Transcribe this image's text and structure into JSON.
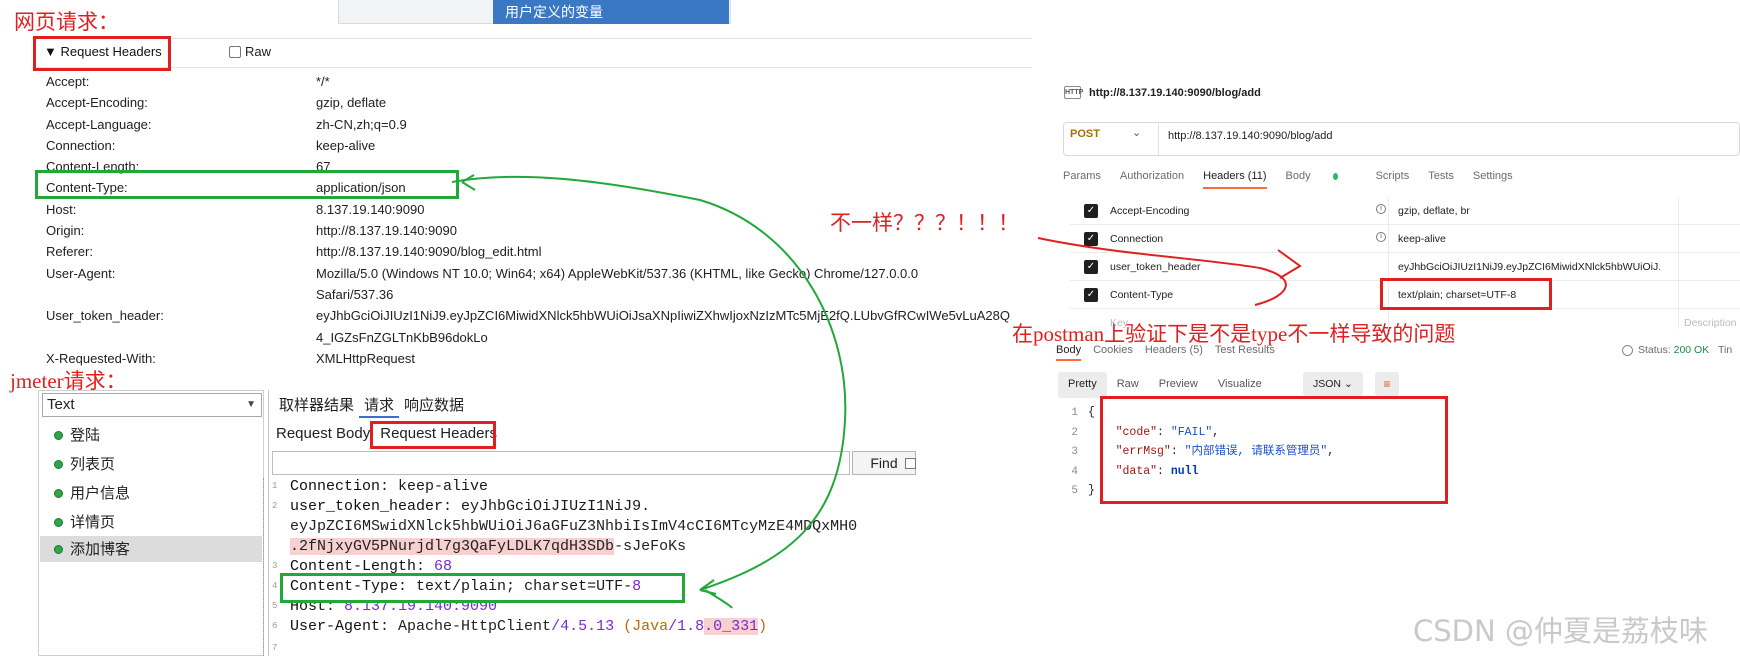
{
  "annotations": {
    "web_request": "网页请求：",
    "jmeter_request": "jmeter请求：",
    "question": "不一样？？？！！！",
    "postman_note": "在postman上验证下是不是type不一样导致的问题",
    "top_fragment": "''''"
  },
  "browser": {
    "top_tab": "用户定义的变量",
    "section_title": "Request Headers",
    "raw_label": "Raw",
    "headers": [
      {
        "name": "Accept:",
        "value": "*/*"
      },
      {
        "name": "Accept-Encoding:",
        "value": "gzip, deflate"
      },
      {
        "name": "Accept-Language:",
        "value": "zh-CN,zh;q=0.9"
      },
      {
        "name": "Connection:",
        "value": "keep-alive"
      },
      {
        "name": "Content-Length:",
        "value": "67"
      },
      {
        "name": "Content-Type:",
        "value": "application/json"
      },
      {
        "name": "Host:",
        "value": "8.137.19.140:9090"
      },
      {
        "name": "Origin:",
        "value": "http://8.137.19.140:9090"
      },
      {
        "name": "Referer:",
        "value": "http://8.137.19.140:9090/blog_edit.html"
      },
      {
        "name": "User-Agent:",
        "value": "Mozilla/5.0 (Windows NT 10.0; Win64; x64) AppleWebKit/537.36 (KHTML, like Gecko) Chrome/127.0.0.0 Safari/537.36"
      },
      {
        "name": "User_token_header:",
        "value": "eyJhbGciOiJIUzI1NiJ9.eyJpZCI6MiwidXNlck5hbWUiOiJsaXNpIiwiZXhwIjoxNzIzMTc5MjE2fQ.LUbvGfRCwIWe5vLuA28Q4_IGZsFnZGLTnKbB96dokLo"
      },
      {
        "name": "X-Requested-With:",
        "value": "XMLHttpRequest"
      }
    ]
  },
  "jmeter": {
    "combo_value": "Text",
    "tree": [
      "登陆",
      "列表页",
      "用户信息",
      "详情页",
      "添加博客"
    ],
    "tabs": [
      "取样器结果",
      "请求",
      "响应数据"
    ],
    "subtabs": [
      "Request Body",
      "Request Headers"
    ],
    "find_label": "Find",
    "code": {
      "l1_key": "Connection",
      "l1_val": "keep-alive",
      "l2_key": "user_token_header",
      "l2_val": "eyJhbGciOiJIUzI1NiJ9.",
      "l3": "eyJpZCI6MSwidXNlck5hbWUiOiJ6aGFuZ3NhbiIsImV4cCI6MTcyMzE4MDQxMH0",
      "l4_hl": ".2fNjxyGV5PNurjdl7g3QaFyLDLK7qdH3SDb",
      "l4_rest": "-sJeFoKs",
      "l5_key": "Content-Length",
      "l5_val": "68",
      "l6_key": "Content-Type",
      "l6_val_a": "text/plain; charset=UTF-",
      "l6_val_b": "8",
      "l7_key": "Host",
      "l7_val": "8.137.19.140:9090",
      "l8_key": "User-Agent",
      "l8_a": "Apache-HttpClient",
      "l8_b": "/4.5.13",
      "l8_c": "(Java",
      "l8_d": "/1.8",
      "l8_e": ".0_331",
      "l8_f": ")",
      "line_numbers": [
        "1",
        "2",
        "",
        "",
        "3",
        "4",
        "5",
        "6",
        "7"
      ]
    }
  },
  "postman": {
    "url_title": "http://8.137.19.140:9090/blog/add",
    "method": "POST",
    "url": "http://8.137.19.140:9090/blog/add",
    "http_badge": "HTTP",
    "tabs": [
      "Params",
      "Authorization",
      "Headers (11)",
      "Body",
      "Scripts",
      "Tests",
      "Settings"
    ],
    "header_rows": [
      {
        "key": "Accept-Encoding",
        "value": "gzip, deflate, br",
        "info": true
      },
      {
        "key": "Connection",
        "value": "keep-alive",
        "info": true
      },
      {
        "key": "user_token_header",
        "value": "eyJhbGciOiJIUzI1NiJ9.eyJpZCI6MiwidXNlck5hbWUiOiJ...",
        "info": false
      },
      {
        "key": "Content-Type",
        "value": "text/plain; charset=UTF-8",
        "info": false
      }
    ],
    "key_placeholder": "Key",
    "description_placeholder": "Description",
    "body_tabs": [
      "Body",
      "Cookies",
      "Headers (5)",
      "Test Results"
    ],
    "status_label": "Status:",
    "status_value": "200 OK",
    "status_trail": "Tin",
    "view_tabs": [
      "Pretty",
      "Raw",
      "Preview",
      "Visualize"
    ],
    "format": "JSON",
    "json": {
      "l1": "{",
      "code_key": "\"code\"",
      "code_val": "\"FAIL\"",
      "err_key": "\"errMsg\"",
      "err_val": "\"内部错误, 请联系管理员\"",
      "data_key": "\"data\"",
      "data_val": "null",
      "l5": "}"
    }
  },
  "watermark": "CSDN @仲夏是荔枝味",
  "colors": {
    "annotation_red": "#e02020",
    "annotation_green": "#21a838",
    "postman_orange": "#ff6c37"
  }
}
